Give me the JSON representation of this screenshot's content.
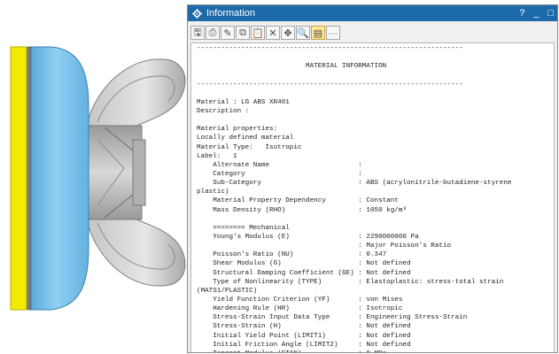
{
  "window": {
    "title": "Information",
    "controls": [
      "?",
      "_",
      "□"
    ]
  },
  "toolbar": {
    "buttons": [
      {
        "name": "save-report-button",
        "glyph": "🖫"
      },
      {
        "name": "print-button",
        "glyph": "⎙"
      },
      {
        "name": "plot-button",
        "glyph": "✎"
      },
      {
        "name": "copy-button",
        "glyph": "⧉"
      },
      {
        "name": "paste-button",
        "glyph": "📋"
      },
      {
        "name": "clear-button",
        "glyph": "✕"
      },
      {
        "name": "pin-button",
        "glyph": "✥"
      },
      {
        "name": "find-button",
        "glyph": "🔍"
      },
      {
        "name": "report-view-button",
        "glyph": "▤"
      },
      {
        "name": "collapse-button",
        "glyph": "—"
      }
    ]
  },
  "report": {
    "lines": [
      "------------------------------------------------------------------",
      "",
      "                           MATERIAL INFORMATION",
      "",
      "------------------------------------------------------------------",
      "",
      "Material : LG ABS XR401",
      "Description :",
      "",
      "Material properties:",
      "Locally defined material",
      "Material Type:   Isotropic",
      "Label:   1",
      "    Alternate Name                      :",
      "    Category                            :",
      "    Sub-Category                        : ABS (acrylonitrile-butadiene-styrene",
      "plastic)",
      "    Material Property Dependency        : Constant",
      "    Mass Density (RHO)                  : 1050 kg/m³",
      "",
      "    ======== Mechanical",
      "    Young's Modulus (E)                 : 2290000000 Pa",
      "                                        : Major Poisson's Ratio",
      "    Poisson's Ratio (NU)                : 0.347",
      "    Shear Modulus (G)                   : Not defined",
      "    Structural Damping Coefficient (GE) : Not defined",
      "    Type of Nonlinearity (TYPE)         : Elastoplastic: stress-total strain",
      "(MATS1/PLASTIC)",
      "    Yield Function Criterion (YF)       : von Mises",
      "    Hardening Rule (HR)                 : Isotropic",
      "    Stress-Strain Input Data Type       : Engineering Stress-Strain",
      "    Stress-Strain (H)                   : Not defined",
      "    Initial Yield Point (LIMIT1)        : Not defined",
      "    Initial Friction Angle (LIMIT2)     : Not defined",
      "    Tangent Modulus (ETAN)              : 0 MPa"
    ]
  },
  "colors": {
    "titlebar": "#1c6aa9",
    "model_yellow": "#f4ea00",
    "model_blue": "#7ec4ee",
    "model_gray": "#b8b8b8"
  }
}
